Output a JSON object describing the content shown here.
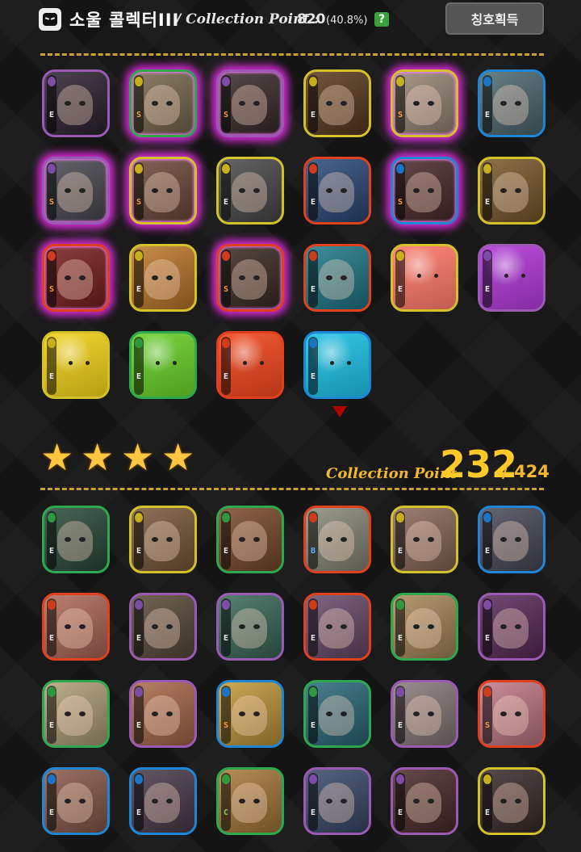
{
  "header": {
    "title": "소울 콜렉터III",
    "collection_point_label": "/ Collection Point :",
    "collection_point_value": "820",
    "collection_point_percent": "(40.8%)",
    "help_label": "?",
    "button_label": "칭호획득"
  },
  "collected_section": {
    "cards": [
      {
        "border": "#9b59b6",
        "glow": false,
        "element": "dark",
        "grade": "E",
        "tone": "#2c2230"
      },
      {
        "border": "#2ea84f",
        "glow": true,
        "element": "light",
        "grade": "S",
        "tone": "#7a6a4e"
      },
      {
        "border": "#9b59b6",
        "glow": true,
        "element": "dark",
        "grade": "S",
        "tone": "#3a2a2a"
      },
      {
        "border": "#d4c12a",
        "glow": false,
        "element": "light",
        "grade": "E",
        "tone": "#5a3a1e"
      },
      {
        "border": "#d4c12a",
        "glow": true,
        "element": "light",
        "grade": "S",
        "tone": "#9a8878"
      },
      {
        "border": "#1f86d6",
        "glow": false,
        "element": "water",
        "grade": "E",
        "tone": "#4e6a72"
      },
      {
        "border": "#9b59b6",
        "glow": true,
        "element": "dark",
        "grade": "S",
        "tone": "#4a4a52"
      },
      {
        "border": "#d4c12a",
        "glow": true,
        "element": "light",
        "grade": "S",
        "tone": "#6e4a3a"
      },
      {
        "border": "#d4c12a",
        "glow": false,
        "element": "light",
        "grade": "E",
        "tone": "#4a4a4a"
      },
      {
        "border": "#e0401e",
        "glow": false,
        "element": "fire",
        "grade": "E",
        "tone": "#2a4a7a"
      },
      {
        "border": "#1f86d6",
        "glow": true,
        "element": "water",
        "grade": "S",
        "tone": "#4a2a2a"
      },
      {
        "border": "#d4c12a",
        "glow": false,
        "element": "light",
        "grade": "E",
        "tone": "#7a5a2a"
      },
      {
        "border": "#e0401e",
        "glow": true,
        "element": "fire",
        "grade": "S",
        "tone": "#7a1e1e"
      },
      {
        "border": "#d4c12a",
        "glow": false,
        "element": "light",
        "grade": "E",
        "tone": "#c27a2a"
      },
      {
        "border": "#e0401e",
        "glow": true,
        "element": "fire",
        "grade": "S",
        "tone": "#3a2a22"
      },
      {
        "border": "#e0401e",
        "glow": false,
        "element": "fire",
        "grade": "E",
        "tone": "#1e7a8a"
      },
      {
        "border": "#d4c12a",
        "glow": false,
        "element": "light",
        "grade": "E",
        "tone": "#ff7a6a",
        "blob": true
      },
      {
        "border": "#9b59b6",
        "glow": false,
        "element": "dark",
        "grade": "E",
        "tone": "#b13ad6",
        "blob": true
      },
      {
        "border": "#d4c12a",
        "glow": false,
        "element": "light",
        "grade": "E",
        "tone": "#f2d31a",
        "blob": true
      },
      {
        "border": "#2ea84f",
        "glow": false,
        "element": "wind",
        "grade": "E",
        "tone": "#6ad12a",
        "blob": true
      },
      {
        "border": "#e0401e",
        "glow": false,
        "element": "fire",
        "grade": "E",
        "tone": "#f2481e",
        "blob": true
      },
      {
        "border": "#1f86d6",
        "glow": false,
        "element": "water",
        "grade": "E",
        "tone": "#1ec2e6",
        "blob": true
      }
    ]
  },
  "rank_section": {
    "stars": 4,
    "collection_point_label": "Collection Point",
    "collection_point_value": "232",
    "collection_point_total": "/ 424",
    "cards": [
      {
        "border": "#2ea84f",
        "element": "wind",
        "grade": "E",
        "tone": "#2a4a3a"
      },
      {
        "border": "#d4c12a",
        "element": "light",
        "grade": "E",
        "tone": "#7a5a3a"
      },
      {
        "border": "#2ea84f",
        "element": "wind",
        "grade": "E",
        "tone": "#7a4a2a"
      },
      {
        "border": "#e0401e",
        "element": "fire",
        "grade": "B",
        "tone": "#8a8a7a"
      },
      {
        "border": "#d4c12a",
        "element": "light",
        "grade": "E",
        "tone": "#8a6a5a"
      },
      {
        "border": "#1f86d6",
        "element": "water",
        "grade": "E",
        "tone": "#4a4a5a"
      },
      {
        "border": "#e0401e",
        "element": "fire",
        "grade": "E",
        "tone": "#b26a5a"
      },
      {
        "border": "#9b59b6",
        "element": "dark",
        "grade": "E",
        "tone": "#5a4a3a"
      },
      {
        "border": "#9b59b6",
        "element": "dark",
        "grade": "E",
        "tone": "#3a6a5a"
      },
      {
        "border": "#e0401e",
        "element": "fire",
        "grade": "E",
        "tone": "#6a4a6a"
      },
      {
        "border": "#2ea84f",
        "element": "wind",
        "grade": "E",
        "tone": "#aa8a5a"
      },
      {
        "border": "#9b59b6",
        "element": "dark",
        "grade": "E",
        "tone": "#5a2a5a"
      },
      {
        "border": "#2ea84f",
        "element": "wind",
        "grade": "E",
        "tone": "#b2a27a"
      },
      {
        "border": "#9b59b6",
        "element": "dark",
        "grade": "E",
        "tone": "#aa6a4a"
      },
      {
        "border": "#1f86d6",
        "element": "water",
        "grade": "S",
        "tone": "#c29a3a"
      },
      {
        "border": "#2ea84f",
        "element": "wind",
        "grade": "E",
        "tone": "#2a6a7a"
      },
      {
        "border": "#9b59b6",
        "element": "dark",
        "grade": "E",
        "tone": "#8a7a7a"
      },
      {
        "border": "#e0401e",
        "element": "fire",
        "grade": "S",
        "tone": "#c27a8a"
      },
      {
        "border": "#1f86d6",
        "element": "water",
        "grade": "E",
        "tone": "#8a5a4a"
      },
      {
        "border": "#1f86d6",
        "element": "water",
        "grade": "E",
        "tone": "#4a3a4a"
      },
      {
        "border": "#2ea84f",
        "element": "wind",
        "grade": "C",
        "tone": "#aa7a3a"
      },
      {
        "border": "#9b59b6",
        "element": "dark",
        "grade": "E",
        "tone": "#3a4a6a"
      },
      {
        "border": "#9b59b6",
        "element": "dark",
        "grade": "E",
        "tone": "#4a2a2a"
      },
      {
        "border": "#d4c12a",
        "element": "light",
        "grade": "E",
        "tone": "#3a2a2a"
      }
    ]
  },
  "colors": {
    "background": "#151515",
    "accent_gold": "#ffc928",
    "divider": "#caa233",
    "glow": "#d82ad6"
  },
  "element_icons": {
    "dark": {
      "color": "#7d4ba8",
      "glyph": "☾"
    },
    "light": {
      "color": "#c9b01a",
      "glyph": "✦"
    },
    "fire": {
      "color": "#d23a1a",
      "glyph": "♨"
    },
    "water": {
      "color": "#1a74c9",
      "glyph": "💧"
    },
    "wind": {
      "color": "#2e9a3e",
      "glyph": "≈"
    }
  }
}
